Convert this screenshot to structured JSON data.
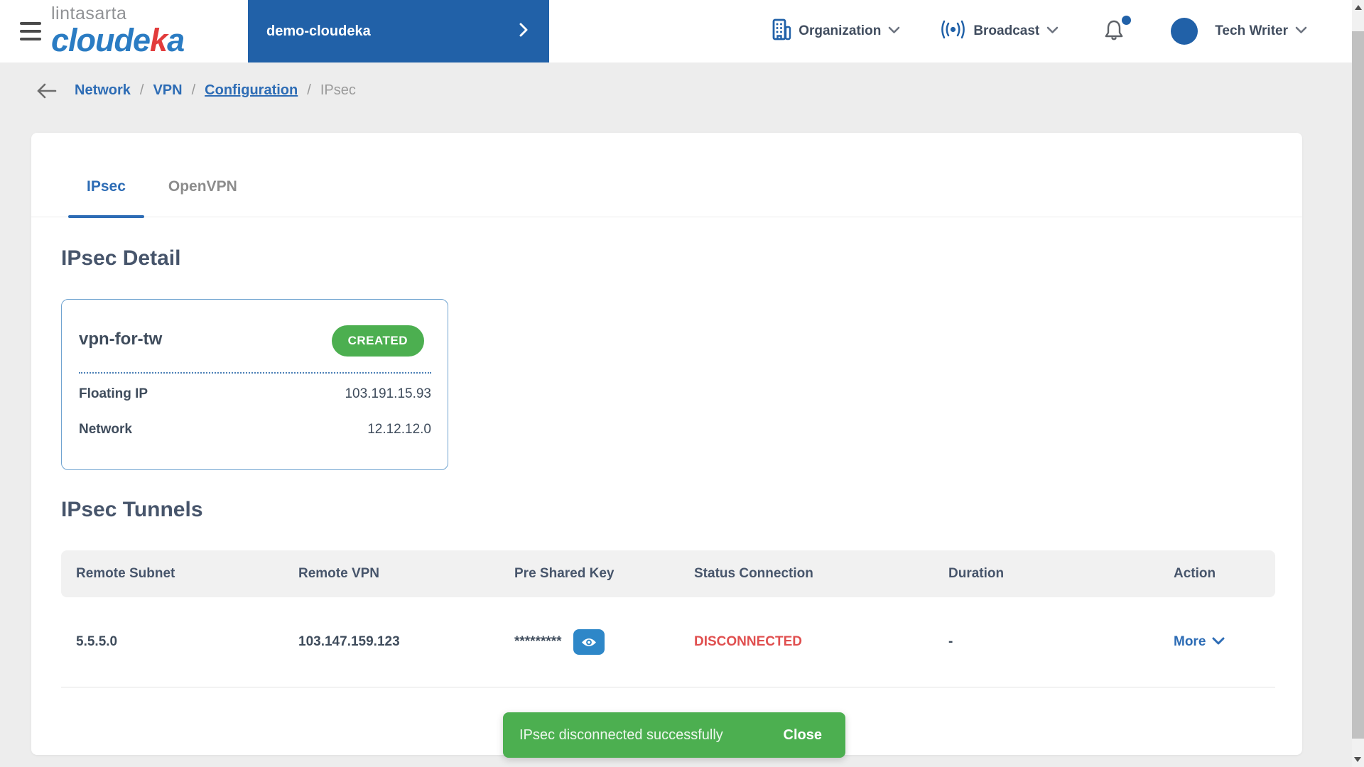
{
  "colors": {
    "brand_blue": "#2161a8",
    "link_blue": "#2d6cb5",
    "logo_blue": "#2b7cc3",
    "logo_red": "#e23b3b",
    "success_green": "#4caf50",
    "danger_red": "#e04f4f",
    "eye_button_blue": "#2e87c8"
  },
  "header": {
    "logo": {
      "line1": "lintasarta",
      "brand_pre": "cloude",
      "brand_accent": "k",
      "brand_post": "a"
    },
    "project_name": "demo-cloudeka",
    "organization_label": "Organization",
    "broadcast_label": "Broadcast",
    "user_name": "Tech Writer"
  },
  "breadcrumb": {
    "separator": "/",
    "items": [
      {
        "label": "Network"
      },
      {
        "label": "VPN"
      },
      {
        "label": "Configuration"
      },
      {
        "label": "IPsec"
      }
    ]
  },
  "tabs": [
    {
      "label": "IPsec"
    },
    {
      "label": "OpenVPN"
    }
  ],
  "ipsec_detail": {
    "heading": "IPsec Detail",
    "name": "vpn-for-tw",
    "status": "CREATED",
    "fields": [
      {
        "label": "Floating IP",
        "value": "103.191.15.93"
      },
      {
        "label": "Network",
        "value": "12.12.12.0"
      }
    ]
  },
  "ipsec_tunnels": {
    "heading": "IPsec Tunnels",
    "columns": [
      "Remote Subnet",
      "Remote VPN",
      "Pre Shared Key",
      "Status Connection",
      "Duration",
      "Action"
    ],
    "rows": [
      {
        "remote_subnet": "5.5.5.0",
        "remote_vpn": "103.147.159.123",
        "pre_shared_key_masked": "*********",
        "status": "DISCONNECTED",
        "duration": "-",
        "action_label": "More"
      }
    ]
  },
  "toast": {
    "message": "IPsec disconnected successfully",
    "close_label": "Close"
  }
}
